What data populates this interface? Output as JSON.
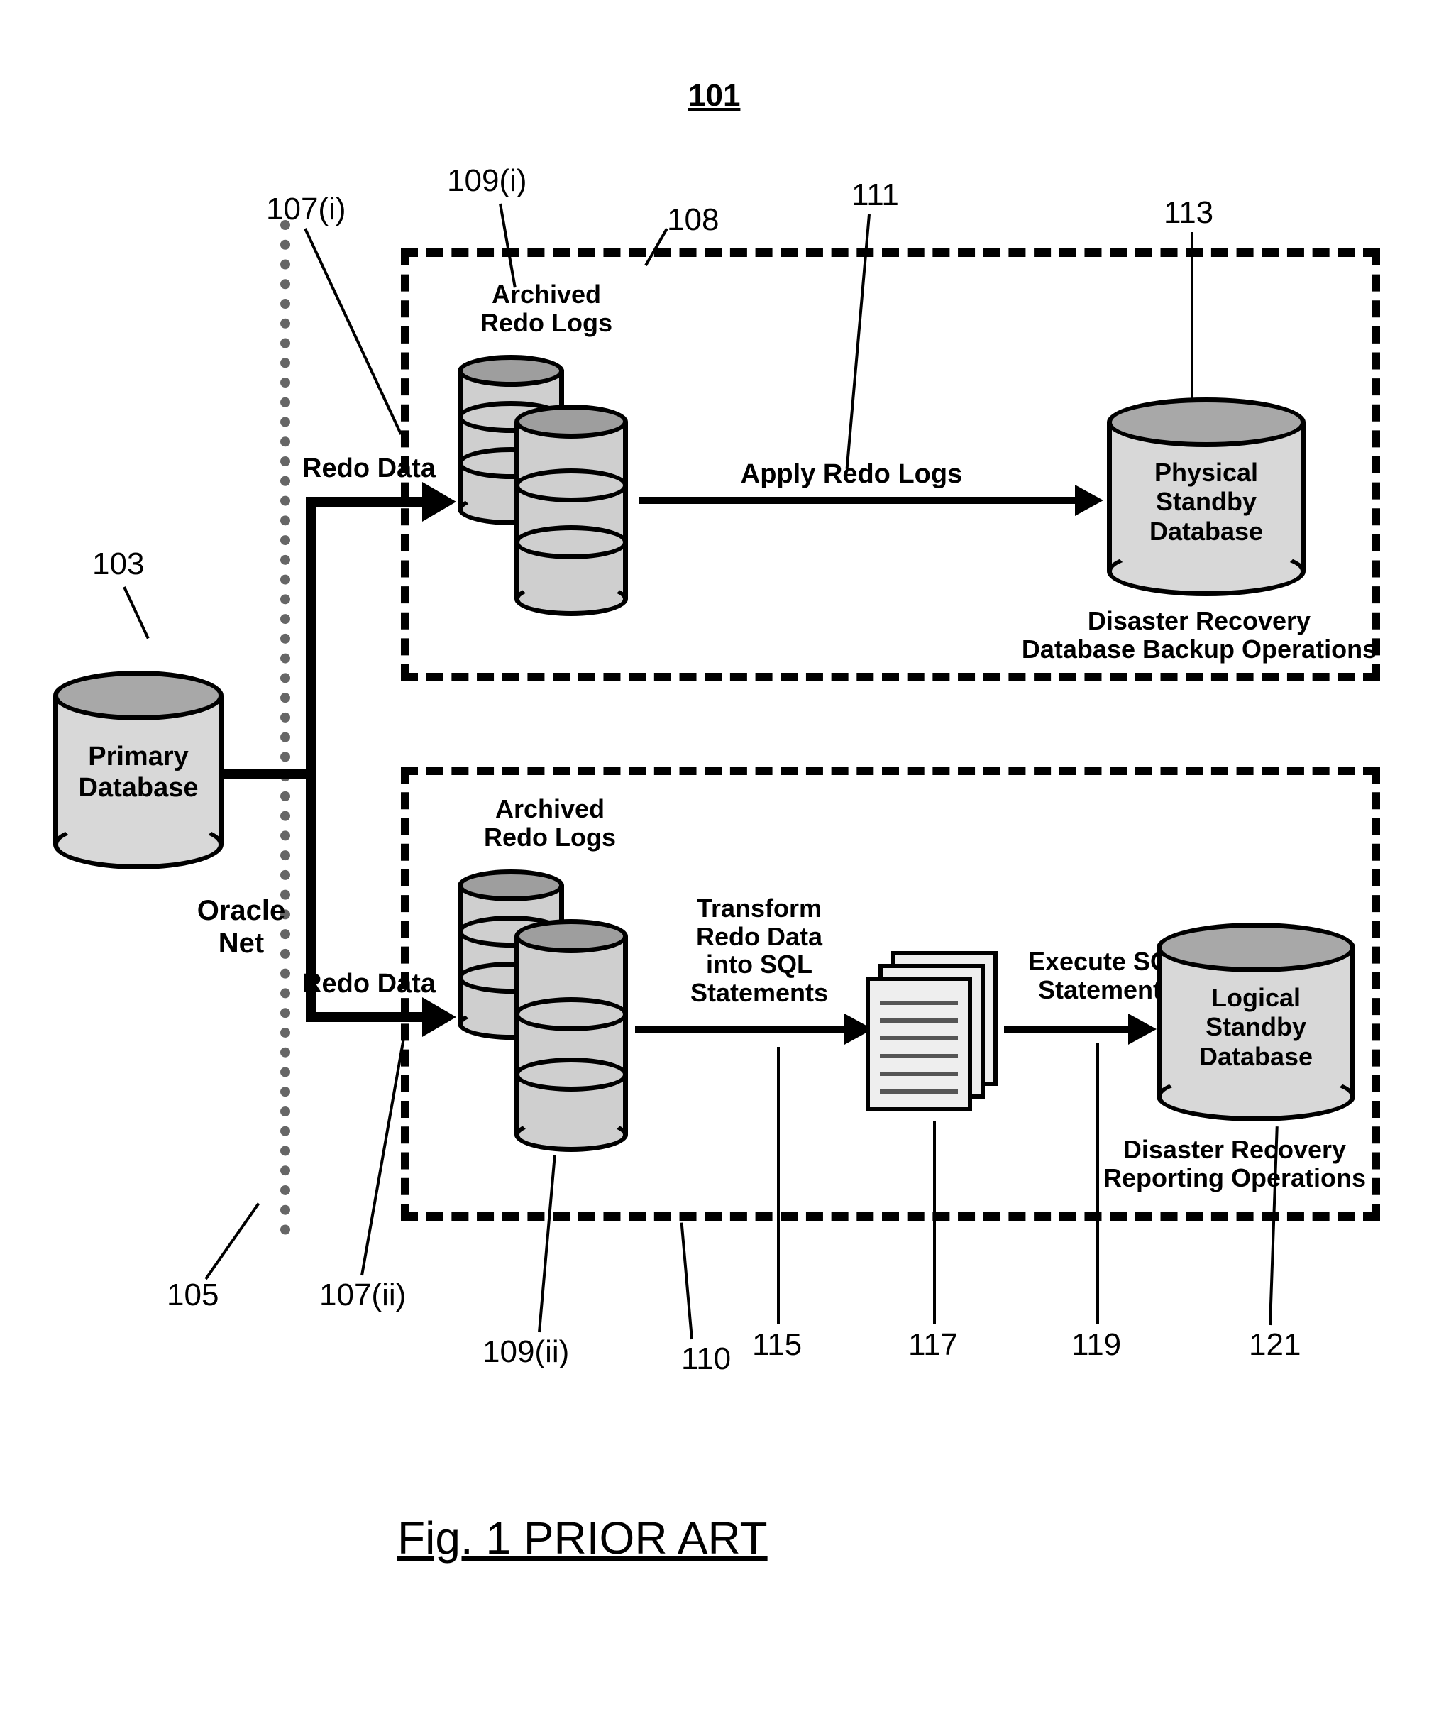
{
  "figure_number": "101",
  "figure_caption": "Fig. 1 PRIOR ART",
  "refs": {
    "r103": "103",
    "r105": "105",
    "r107i": "107(i)",
    "r107ii": "107(ii)",
    "r108": "108",
    "r109i": "109(i)",
    "r109ii": "109(ii)",
    "r110": "110",
    "r111": "111",
    "r113": "113",
    "r115": "115",
    "r117": "117",
    "r119": "119",
    "r121": "121"
  },
  "labels": {
    "primary_db": "Primary\nDatabase",
    "oracle_net": "Oracle\nNet",
    "redo_data_top": "Redo Data",
    "redo_data_bottom": "Redo Data",
    "archived_top": "Archived\nRedo Logs",
    "archived_bottom": "Archived\nRedo Logs",
    "apply_redo": "Apply Redo Logs",
    "physical_db": "Physical\nStandby\nDatabase",
    "physical_caption": "Disaster Recovery\nDatabase Backup Operations",
    "transform": "Transform\nRedo Data\ninto SQL\nStatements",
    "execute_sql": "Execute SQL\nStatements",
    "logical_db": "Logical\nStandby\nDatabase",
    "logical_caption": "Disaster Recovery\nReporting Operations"
  }
}
